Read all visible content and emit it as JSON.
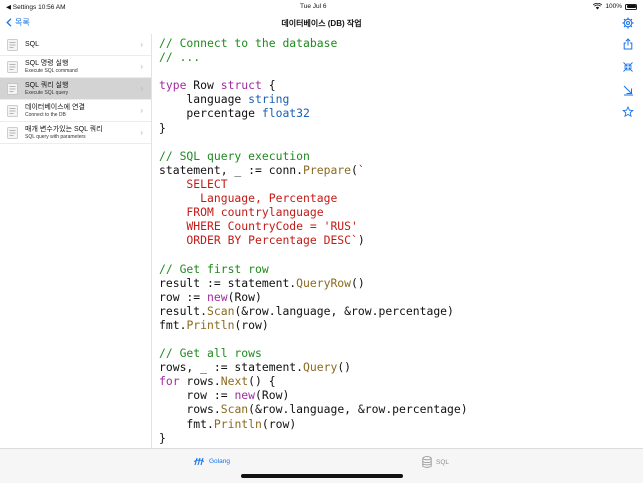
{
  "status": {
    "left": "◀ Settings  10:56 AM",
    "center": "Tue Jul 6",
    "battery": "100%"
  },
  "nav": {
    "back_label": "목록",
    "title": "데이터베이스 (DB) 작업"
  },
  "sidebar": {
    "items": [
      {
        "title": "SQL",
        "subtitle": "",
        "active": false
      },
      {
        "title": "SQL 명령 실행",
        "subtitle": "Execute SQL command",
        "active": false
      },
      {
        "title": "SQL 쿼리 실행",
        "subtitle": "Execute SQL query",
        "active": true
      },
      {
        "title": "데이터베이스에 연결",
        "subtitle": "Connect to the DB",
        "active": false
      },
      {
        "title": "매개 변수가있는 SQL 쿼리",
        "subtitle": "SQL query with parameters",
        "active": false
      }
    ]
  },
  "code": [
    [
      {
        "t": "// Connect to the database",
        "c": "cm"
      }
    ],
    [
      {
        "t": "// ...",
        "c": "cm"
      }
    ],
    [],
    [
      {
        "t": "type",
        "c": "kw"
      },
      {
        "t": " Row "
      },
      {
        "t": "struct",
        "c": "kw"
      },
      {
        "t": " {"
      }
    ],
    [
      {
        "t": "    language "
      },
      {
        "t": "string",
        "c": "ty"
      }
    ],
    [
      {
        "t": "    percentage "
      },
      {
        "t": "float32",
        "c": "ty"
      }
    ],
    [
      {
        "t": "}"
      }
    ],
    [],
    [
      {
        "t": "// SQL query execution",
        "c": "cm"
      }
    ],
    [
      {
        "t": "statement, _ := conn."
      },
      {
        "t": "Prepare",
        "c": "fn"
      },
      {
        "t": "("
      },
      {
        "t": "`",
        "c": "str"
      }
    ],
    [
      {
        "t": "    SELECT",
        "c": "str"
      }
    ],
    [
      {
        "t": "      Language, Percentage",
        "c": "str"
      }
    ],
    [
      {
        "t": "    FROM countrylanguage",
        "c": "str"
      }
    ],
    [
      {
        "t": "    WHERE CountryCode = 'RUS'",
        "c": "str"
      }
    ],
    [
      {
        "t": "    ORDER BY Percentage DESC`",
        "c": "str"
      },
      {
        "t": ")"
      }
    ],
    [],
    [
      {
        "t": "// Get first row",
        "c": "cm"
      }
    ],
    [
      {
        "t": "result := statement."
      },
      {
        "t": "QueryRow",
        "c": "fn"
      },
      {
        "t": "()"
      }
    ],
    [
      {
        "t": "row := "
      },
      {
        "t": "new",
        "c": "kw"
      },
      {
        "t": "(Row)"
      }
    ],
    [
      {
        "t": "result."
      },
      {
        "t": "Scan",
        "c": "fn"
      },
      {
        "t": "(&row.language, &row.percentage)"
      }
    ],
    [
      {
        "t": "fmt."
      },
      {
        "t": "Println",
        "c": "fn"
      },
      {
        "t": "(row)"
      }
    ],
    [],
    [
      {
        "t": "// Get all rows",
        "c": "cm"
      }
    ],
    [
      {
        "t": "rows, _ := statement."
      },
      {
        "t": "Query",
        "c": "fn"
      },
      {
        "t": "()"
      }
    ],
    [
      {
        "t": "for",
        "c": "kw"
      },
      {
        "t": " rows."
      },
      {
        "t": "Next",
        "c": "fn"
      },
      {
        "t": "() {"
      }
    ],
    [
      {
        "t": "    row := "
      },
      {
        "t": "new",
        "c": "kw"
      },
      {
        "t": "(Row)"
      }
    ],
    [
      {
        "t": "    rows."
      },
      {
        "t": "Scan",
        "c": "fn"
      },
      {
        "t": "(&row.language, &row.percentage)"
      }
    ],
    [
      {
        "t": "    fmt."
      },
      {
        "t": "Println",
        "c": "fn"
      },
      {
        "t": "(row)"
      }
    ],
    [
      {
        "t": "}"
      }
    ]
  ],
  "right_icons": [
    "share-icon",
    "collapse-icon",
    "expand-icon",
    "star-icon"
  ],
  "tabs": [
    {
      "label": "Golang",
      "icon": "golang-icon",
      "active": true
    },
    {
      "label": "SQL",
      "icon": "database-icon",
      "active": false
    }
  ],
  "colors": {
    "accent": "#1a73e8",
    "comment": "#1f8a1f",
    "keyword": "#a02ca0",
    "type": "#1a5fb4",
    "function": "#8a6a20",
    "string": "#c41a16"
  }
}
